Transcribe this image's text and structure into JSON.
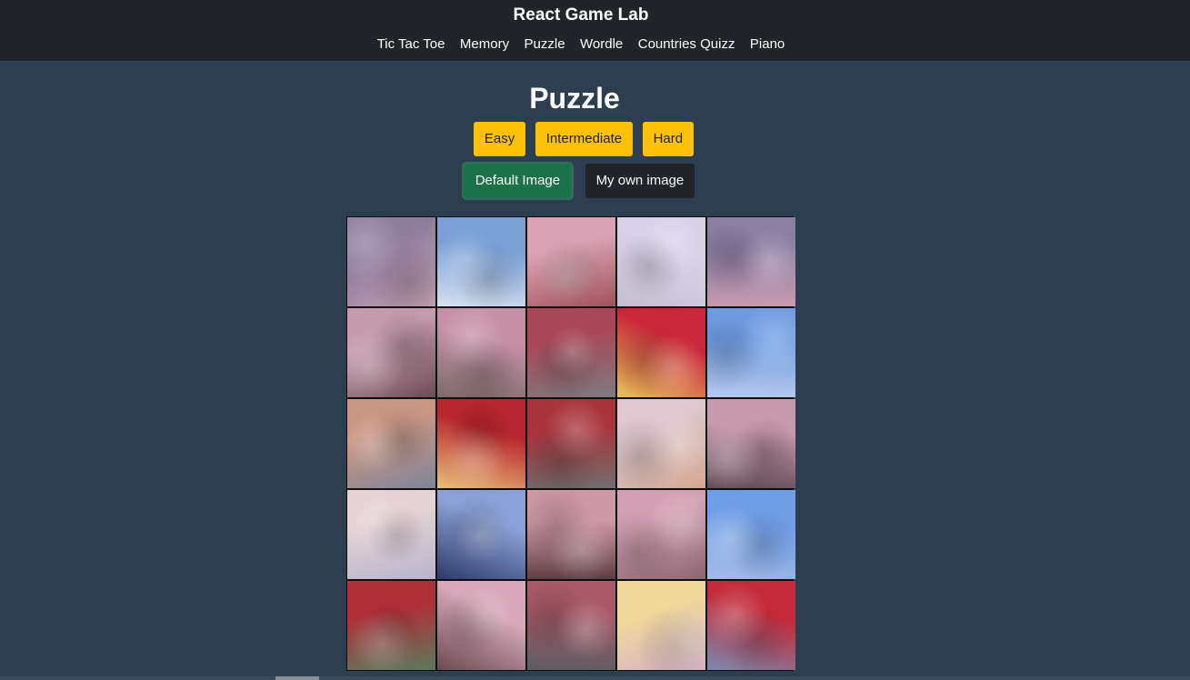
{
  "app": {
    "title": "React Game Lab"
  },
  "nav": {
    "links": [
      "Tic Tac Toe",
      "Memory",
      "Puzzle",
      "Wordle",
      "Countries Quizz",
      "Piano"
    ]
  },
  "page": {
    "title": "Puzzle"
  },
  "difficulty": {
    "buttons": [
      "Easy",
      "Intermediate",
      "Hard"
    ]
  },
  "image_source": {
    "default_label": "Default Image",
    "own_label": "My own image",
    "selected": "Default Image"
  },
  "puzzle": {
    "grid_size": 5,
    "tiles": [
      {
        "name": "valley-town",
        "sky": "#8e7c9c",
        "ground": "#c8a3b4"
      },
      {
        "name": "blue-sky-clouds",
        "sky": "#7ba0d6",
        "ground": "#d6e0f0"
      },
      {
        "name": "cherry-blossom-roof",
        "sky": "#d9a2b4",
        "ground": "#a0525c"
      },
      {
        "name": "pale-sky-cloud",
        "sky": "#d8d2e8",
        "ground": "#c7bfcf"
      },
      {
        "name": "mountain-town",
        "sky": "#8a7ea3",
        "ground": "#c99bb0"
      },
      {
        "name": "blossom-branches",
        "sky": "#c59cad",
        "ground": "#6c4b55"
      },
      {
        "name": "blossom-roof-edge",
        "sky": "#c490a6",
        "ground": "#7c6b6b"
      },
      {
        "name": "pagoda-roof-left",
        "sky": "#a9475a",
        "ground": "#7d7c80"
      },
      {
        "name": "pagoda-sunset",
        "sky": "#c9283a",
        "ground": "#e7c35a"
      },
      {
        "name": "clear-blue-sky",
        "sky": "#6e9ae0",
        "ground": "#b8c9ee"
      },
      {
        "name": "city-sunset",
        "sky": "#c99684",
        "ground": "#7e8599"
      },
      {
        "name": "pagoda-balcony",
        "sky": "#b8262f",
        "ground": "#e8c17a"
      },
      {
        "name": "pagoda-roof-center",
        "sky": "#a9343c",
        "ground": "#6f6e70"
      },
      {
        "name": "hazy-mountain-sky",
        "sky": "#dec8d0",
        "ground": "#d4a890"
      },
      {
        "name": "blossom-dark-branches",
        "sky": "#c89aad",
        "ground": "#5c4650"
      },
      {
        "name": "fuji-peak",
        "sky": "#e4d2d4",
        "ground": "#b8b4cc"
      },
      {
        "name": "pagoda-spire",
        "sky": "#8aa0d6",
        "ground": "#2c3a6a"
      },
      {
        "name": "lantern-blossoms",
        "sky": "#cf9aa8",
        "ground": "#5d3d42"
      },
      {
        "name": "pink-blossoms",
        "sky": "#d1a0b2",
        "ground": "#8b6570"
      },
      {
        "name": "sky-gradient",
        "sky": "#6f9de6",
        "ground": "#a5bbe8"
      },
      {
        "name": "pagoda-corner",
        "sky": "#b0303a",
        "ground": "#5a7a5a"
      },
      {
        "name": "blossom-cluster",
        "sky": "#d7a9ba",
        "ground": "#6a4a52"
      },
      {
        "name": "roof-tiles",
        "sky": "#a85a6a",
        "ground": "#5c5c62"
      },
      {
        "name": "golden-sunset",
        "sky": "#f0d89a",
        "ground": "#d7b0c8"
      },
      {
        "name": "pagoda-red-eaves",
        "sky": "#c42a3a",
        "ground": "#7a8ab0"
      }
    ]
  },
  "colors": {
    "navbar": "#212529",
    "background": "#2d3e50",
    "warning": "#ffc107",
    "success": "#1a7249"
  }
}
